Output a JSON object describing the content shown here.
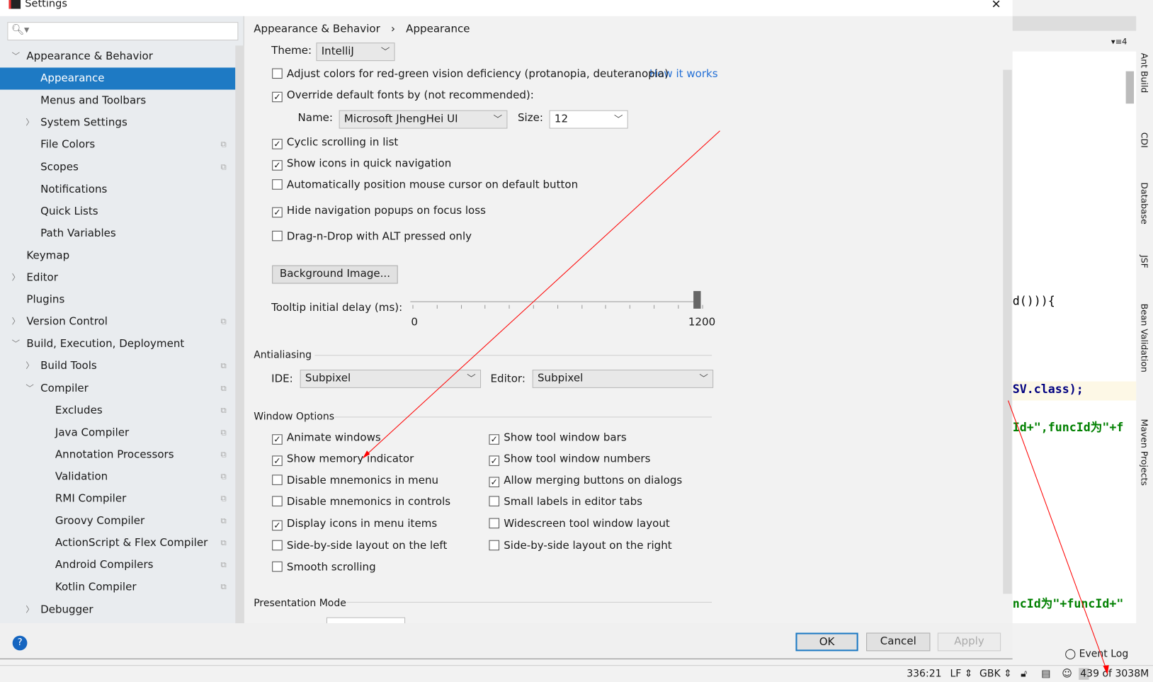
{
  "window": {
    "title": "Settings",
    "close": "✕"
  },
  "search": {
    "placeholder": ""
  },
  "sidebar": {
    "items": [
      {
        "label": "Appearance & Behavior",
        "level": 0,
        "arrow": "down"
      },
      {
        "label": "Appearance",
        "level": 1,
        "selected": true
      },
      {
        "label": "Menus and Toolbars",
        "level": 1
      },
      {
        "label": "System Settings",
        "level": 1,
        "arrow": "right"
      },
      {
        "label": "File Colors",
        "level": 1,
        "copy": true
      },
      {
        "label": "Scopes",
        "level": 1,
        "copy": true
      },
      {
        "label": "Notifications",
        "level": 1
      },
      {
        "label": "Quick Lists",
        "level": 1
      },
      {
        "label": "Path Variables",
        "level": 1
      },
      {
        "label": "Keymap",
        "level": 0
      },
      {
        "label": "Editor",
        "level": 0,
        "arrow": "right"
      },
      {
        "label": "Plugins",
        "level": 0
      },
      {
        "label": "Version Control",
        "level": 0,
        "arrow": "right",
        "copy": true
      },
      {
        "label": "Build, Execution, Deployment",
        "level": 0,
        "arrow": "down"
      },
      {
        "label": "Build Tools",
        "level": 1,
        "arrow": "right",
        "copy": true
      },
      {
        "label": "Compiler",
        "level": 1,
        "arrow": "down",
        "copy": true
      },
      {
        "label": "Excludes",
        "level": 2,
        "copy": true
      },
      {
        "label": "Java Compiler",
        "level": 2,
        "copy": true
      },
      {
        "label": "Annotation Processors",
        "level": 2,
        "copy": true
      },
      {
        "label": "Validation",
        "level": 2,
        "copy": true
      },
      {
        "label": "RMI Compiler",
        "level": 2,
        "copy": true
      },
      {
        "label": "Groovy Compiler",
        "level": 2,
        "copy": true
      },
      {
        "label": "ActionScript & Flex Compiler",
        "level": 2,
        "copy": true
      },
      {
        "label": "Android Compilers",
        "level": 2,
        "copy": true
      },
      {
        "label": "Kotlin Compiler",
        "level": 2,
        "copy": true
      },
      {
        "label": "Debugger",
        "level": 1,
        "arrow": "right"
      }
    ]
  },
  "breadcrumb": {
    "parent": "Appearance & Behavior",
    "sep": "›",
    "current": "Appearance"
  },
  "theme": {
    "label": "Theme:",
    "value": "IntelliJ"
  },
  "options_top": [
    {
      "label": "Adjust colors for red-green vision deficiency (protanopia, deuteranopia)",
      "checked": false
    },
    {
      "label": "Override default fonts by (not recommended):",
      "checked": true
    }
  ],
  "how_it_works": "How it works",
  "font": {
    "name_label": "Name:",
    "name_value": "Microsoft JhengHei UI",
    "size_label": "Size:",
    "size_value": "12"
  },
  "options_mid": [
    {
      "label": "Cyclic scrolling in list",
      "checked": true
    },
    {
      "label": "Show icons in quick navigation",
      "checked": true
    },
    {
      "label": "Automatically position mouse cursor on default button",
      "checked": false
    },
    {
      "label": "Hide navigation popups on focus loss",
      "checked": true
    },
    {
      "label": "Drag-n-Drop with ALT pressed only",
      "checked": false
    }
  ],
  "background_image_button": "Background Image...",
  "tooltip": {
    "label": "Tooltip initial delay (ms):",
    "min": "0",
    "max": "1200",
    "value": 1200
  },
  "antialiasing": {
    "title": "Antialiasing",
    "ide_label": "IDE:",
    "ide_value": "Subpixel",
    "editor_label": "Editor:",
    "editor_value": "Subpixel"
  },
  "window_options": {
    "title": "Window Options",
    "left": [
      {
        "label": "Animate windows",
        "checked": true
      },
      {
        "label": "Show memory indicator",
        "checked": true
      },
      {
        "label": "Disable mnemonics in menu",
        "checked": false
      },
      {
        "label": "Disable mnemonics in controls",
        "checked": false
      },
      {
        "label": "Display icons in menu items",
        "checked": true
      },
      {
        "label": "Side-by-side layout on the left",
        "checked": false
      },
      {
        "label": "Smooth scrolling",
        "checked": false
      }
    ],
    "right": [
      {
        "label": "Show tool window bars",
        "checked": true
      },
      {
        "label": "Show tool window numbers",
        "checked": true
      },
      {
        "label": "Allow merging buttons on dialogs",
        "checked": true
      },
      {
        "label": "Small labels in editor tabs",
        "checked": false
      },
      {
        "label": "Widescreen tool window layout",
        "checked": false
      },
      {
        "label": "Side-by-side layout on the right",
        "checked": false
      }
    ]
  },
  "presentation_mode": {
    "title": "Presentation Mode"
  },
  "buttons": {
    "ok": "OK",
    "cancel": "Cancel",
    "apply": "Apply",
    "help": "?"
  },
  "editor": {
    "tab_indicator": "▾≡4",
    "lines": [
      {
        "text": "d())){",
        "color": "#000"
      },
      {
        "text": "SV.class);",
        "color": "#000080"
      },
      {
        "text": "Id+\",funcId为\"+f",
        "color": "#008000"
      },
      {
        "text": "ncId为\"+funcId+\"",
        "color": "#008000"
      }
    ]
  },
  "tool_windows": [
    "Ant Build",
    "CDI",
    "Database",
    "JSF",
    "Bean Validation",
    "Maven Projects"
  ],
  "event_log": "Event Log",
  "status": {
    "position": "336:21",
    "line_sep": "LF ⇕",
    "encoding": "GBK ⇕",
    "memory": "439 of 3038M",
    "memory_used_mb": 439,
    "memory_total_mb": 3038
  },
  "colors": {
    "selection": "#1e7ac4",
    "link": "#2470d6",
    "annotation_arrow": "#ff0000"
  }
}
